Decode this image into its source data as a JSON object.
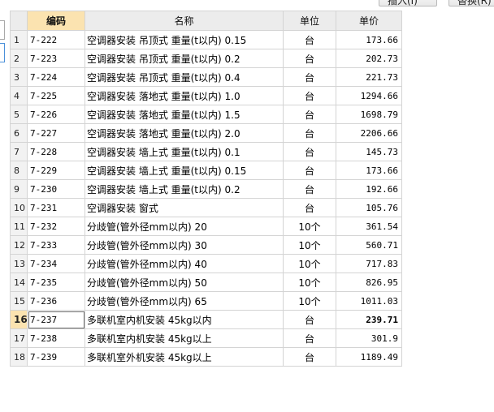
{
  "top_buttons": [
    "插入(I)",
    "替换(R)"
  ],
  "table": {
    "headers": {
      "code": "编码",
      "name": "名称",
      "unit": "单位",
      "price": "单价"
    },
    "active_row": 16,
    "rows": [
      {
        "n": "1",
        "code": "7-222",
        "name": "空调器安装 吊顶式 重量(t以内) 0.15",
        "unit": "台",
        "price": "173.66"
      },
      {
        "n": "2",
        "code": "7-223",
        "name": "空调器安装 吊顶式 重量(t以内) 0.2",
        "unit": "台",
        "price": "202.73"
      },
      {
        "n": "3",
        "code": "7-224",
        "name": "空调器安装 吊顶式 重量(t以内) 0.4",
        "unit": "台",
        "price": "221.73"
      },
      {
        "n": "4",
        "code": "7-225",
        "name": "空调器安装 落地式 重量(t以内) 1.0",
        "unit": "台",
        "price": "1294.66"
      },
      {
        "n": "5",
        "code": "7-226",
        "name": "空调器安装 落地式 重量(t以内) 1.5",
        "unit": "台",
        "price": "1698.79"
      },
      {
        "n": "6",
        "code": "7-227",
        "name": "空调器安装 落地式 重量(t以内) 2.0",
        "unit": "台",
        "price": "2206.66"
      },
      {
        "n": "7",
        "code": "7-228",
        "name": "空调器安装 墙上式 重量(t以内) 0.1",
        "unit": "台",
        "price": "145.73"
      },
      {
        "n": "8",
        "code": "7-229",
        "name": "空调器安装 墙上式 重量(t以内) 0.15",
        "unit": "台",
        "price": "173.66"
      },
      {
        "n": "9",
        "code": "7-230",
        "name": "空调器安装 墙上式 重量(t以内) 0.2",
        "unit": "台",
        "price": "192.66"
      },
      {
        "n": "10",
        "code": "7-231",
        "name": "空调器安装 窗式",
        "unit": "台",
        "price": "105.76"
      },
      {
        "n": "11",
        "code": "7-232",
        "name": "分歧管(管外径mm以内) 20",
        "unit": "10个",
        "price": "361.54"
      },
      {
        "n": "12",
        "code": "7-233",
        "name": "分歧管(管外径mm以内) 30",
        "unit": "10个",
        "price": "560.71"
      },
      {
        "n": "13",
        "code": "7-234",
        "name": "分歧管(管外径mm以内) 40",
        "unit": "10个",
        "price": "717.83"
      },
      {
        "n": "14",
        "code": "7-235",
        "name": "分歧管(管外径mm以内) 50",
        "unit": "10个",
        "price": "826.95"
      },
      {
        "n": "15",
        "code": "7-236",
        "name": "分歧管(管外径mm以内) 65",
        "unit": "10个",
        "price": "1011.03"
      },
      {
        "n": "16",
        "code": "7-237",
        "name": "多联机室内机安装 45kg以内",
        "unit": "台",
        "price": "239.71"
      },
      {
        "n": "17",
        "code": "7-238",
        "name": "多联机室内机安装 45kg以上",
        "unit": "台",
        "price": "301.9"
      },
      {
        "n": "18",
        "code": "7-239",
        "name": "多联机室外机安装 45kg以上",
        "unit": "台",
        "price": "1189.49"
      }
    ]
  }
}
